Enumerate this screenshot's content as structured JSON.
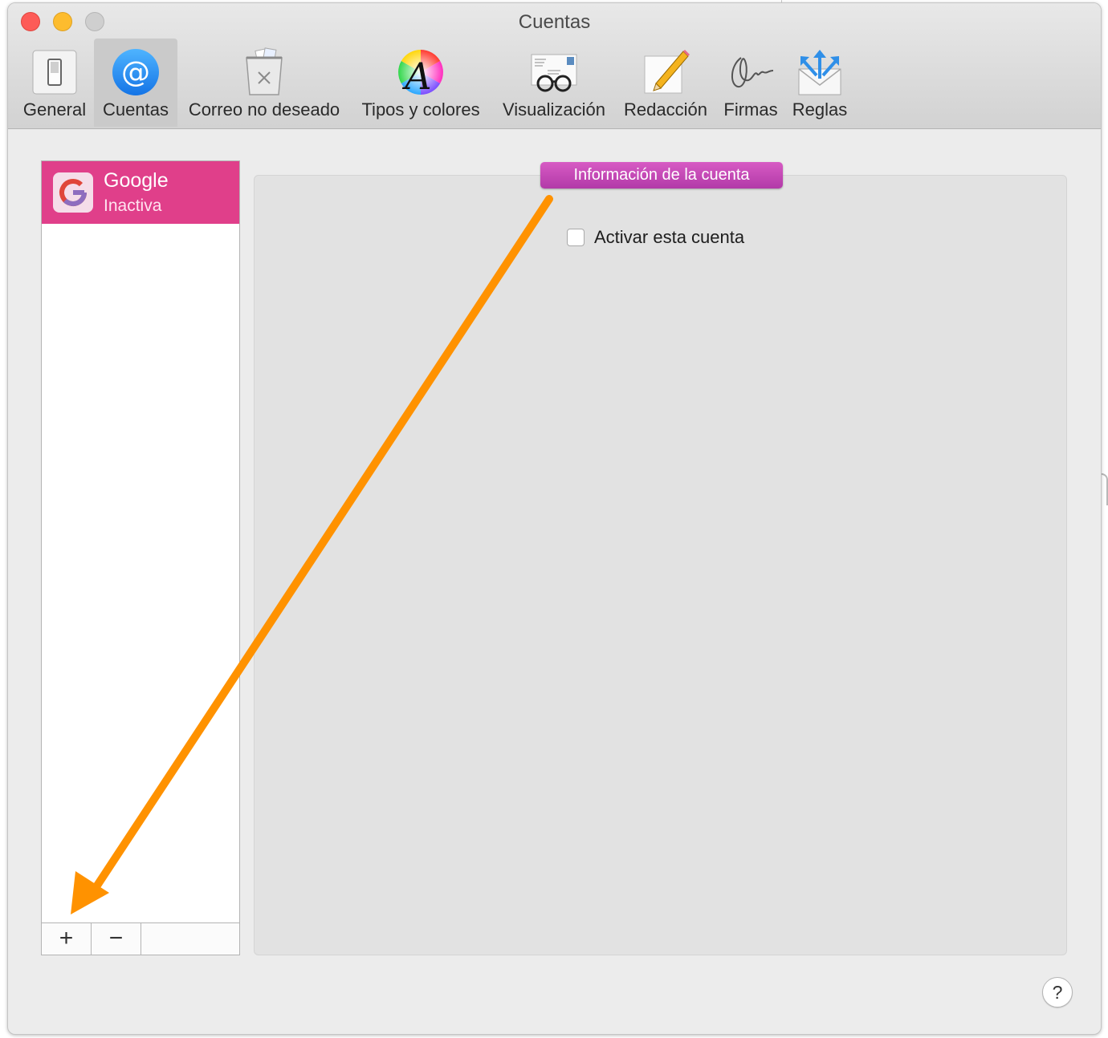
{
  "window": {
    "title": "Cuentas"
  },
  "toolbar": {
    "items": [
      {
        "label": "General",
        "icon": "general-switch-icon",
        "selected": false
      },
      {
        "label": "Cuentas",
        "icon": "at-sign-icon",
        "selected": true
      },
      {
        "label": "Correo no deseado",
        "icon": "junk-trash-icon",
        "selected": false
      },
      {
        "label": "Tipos y colores",
        "icon": "font-color-wheel-icon",
        "selected": false
      },
      {
        "label": "Visualización",
        "icon": "envelope-glasses-icon",
        "selected": false
      },
      {
        "label": "Redacción",
        "icon": "pencil-paper-icon",
        "selected": false
      },
      {
        "label": "Firmas",
        "icon": "signature-icon",
        "selected": false
      },
      {
        "label": "Reglas",
        "icon": "envelope-arrows-icon",
        "selected": false
      }
    ]
  },
  "accounts": {
    "items": [
      {
        "name": "Google",
        "status": "Inactiva",
        "icon": "google-icon"
      }
    ],
    "add_symbol": "+",
    "remove_symbol": "−"
  },
  "account_info": {
    "tab_label": "Información de la cuenta",
    "enable_checkbox_label": "Activar esta cuenta",
    "enable_checked": false
  },
  "help": {
    "symbol": "?"
  },
  "colors": {
    "selected_account": "#e03f8a",
    "info_tab": "#c54bb9",
    "annotation_arrow": "#ff9200"
  }
}
